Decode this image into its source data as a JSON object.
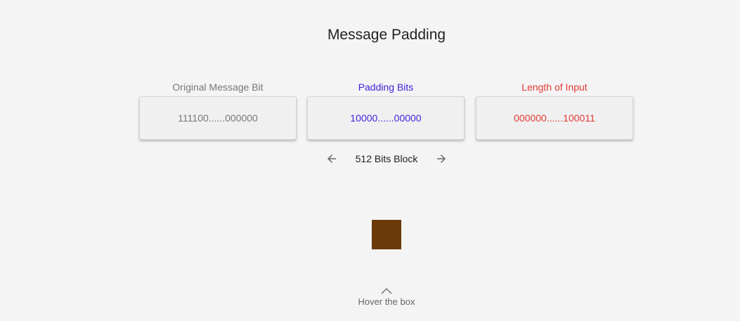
{
  "header": {
    "title": "Message Padding"
  },
  "sections": [
    {
      "label": "Original Message Bit",
      "value": "111100......000000",
      "color": "#777777"
    },
    {
      "label": "Padding Bits",
      "value": "10000......00000",
      "color": "#4422dd"
    },
    {
      "label": "Length of Input",
      "value": "000000......100011",
      "color": "#e53935"
    }
  ],
  "navigator": {
    "prev_icon": "arrow-left-icon",
    "label": "512 Bits Block",
    "next_icon": "arrow-right-icon"
  },
  "box": {
    "color": "#6b3a0b"
  },
  "hint": {
    "icon": "chevron-up-icon",
    "text": "Hover the box"
  }
}
